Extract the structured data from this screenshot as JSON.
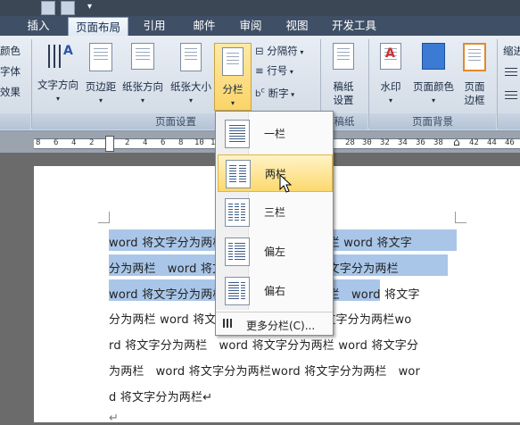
{
  "tabs": [
    "插入",
    "页面布局",
    "引用",
    "邮件",
    "审阅",
    "视图",
    "开发工具"
  ],
  "active_tab": "页面布局",
  "left_clipped": [
    "颜色",
    "字体",
    "效果"
  ],
  "page_setup": {
    "text_direction": "文字方向",
    "margins": "页边距",
    "orientation": "纸张方向",
    "size": "纸张大小",
    "columns": "分栏",
    "breaks": "分隔符",
    "line_numbers": "行号",
    "hyphenation": "断字",
    "group_label": "页面设置"
  },
  "manuscript": {
    "button": "稿纸设置",
    "group_label": "稿纸"
  },
  "page_background": {
    "watermark": "水印",
    "page_color": "页面颜色",
    "page_borders": "页面边框",
    "group_label": "页面背景"
  },
  "right_clipped": "缩进",
  "ruler_numbers": [
    "8",
    "6",
    "4",
    "2",
    "2",
    "4",
    "6",
    "8",
    "10",
    "12",
    "28",
    "30",
    "32",
    "34",
    "36",
    "38",
    "42",
    "44",
    "46"
  ],
  "columns_menu": {
    "items": [
      "一栏",
      "两栏",
      "三栏",
      "偏左",
      "偏右"
    ],
    "selected": "两栏",
    "more": "更多分栏(C)..."
  },
  "document": {
    "lines": [
      "word 将文字分为两栏word 将文字分为两栏 word 将文字",
      "分为两栏   word 将文字分为两栏word 将文字分为两栏",
      "word 将文字分为两栏word 将文字分为两栏   word 将文字",
      "分为两栏 word 将文字分为两栏 word 将文字分为两栏wo",
      "rd 将文字分为两栏   word 将文字分为两栏 word 将文字分",
      "为两栏   word 将文字分为两栏word 将文字分为两栏   wor",
      "d 将文字分为两栏↵",
      "↵"
    ]
  }
}
